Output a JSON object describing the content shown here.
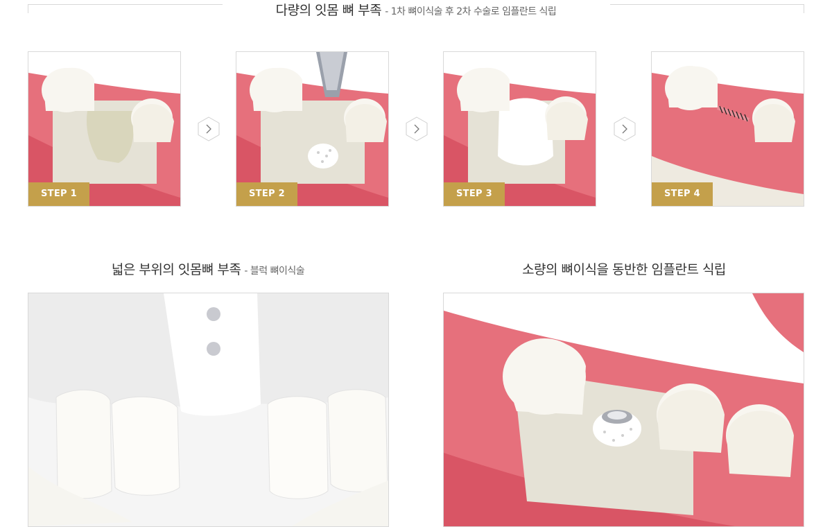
{
  "sections": {
    "staged": {
      "title": "다량의 잇몸 뼈 부족",
      "subtitle": "- 1차 뼈이식술 후 2차 수술로 임플란트 식립"
    },
    "block": {
      "title": "넓은 부위의 잇몸뼈 부족",
      "subtitle": "- 블럭 뼈이식술"
    },
    "simultaneous": {
      "title": "소량의 뼈이식을 동반한 임플란트 식립"
    }
  },
  "steps": [
    {
      "label": "STEP 1"
    },
    {
      "label": "STEP 2"
    },
    {
      "label": "STEP 3"
    },
    {
      "label": "STEP 4"
    }
  ],
  "colors": {
    "badge": "#c4a04b",
    "gum": "#e6707c",
    "bone": "#e5e2d6",
    "tooth": "#f8f6f0",
    "border": "#d8d8d8"
  }
}
